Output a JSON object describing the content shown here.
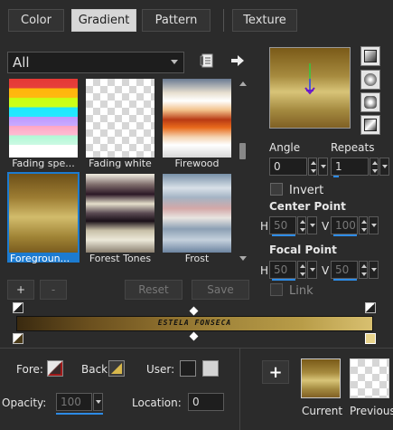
{
  "tabs": [
    {
      "label": "Color",
      "active": false
    },
    {
      "label": "Gradient",
      "active": true
    },
    {
      "label": "Pattern",
      "active": false
    },
    {
      "label": "Texture",
      "active": false
    }
  ],
  "category": {
    "selected": "All"
  },
  "gallery": {
    "items": [
      {
        "label": "Fading spe...",
        "selected": false
      },
      {
        "label": "Fading white",
        "selected": false
      },
      {
        "label": "Firewood",
        "selected": false
      },
      {
        "label": "Foregroun...",
        "selected": true
      },
      {
        "label": "Forest Tones",
        "selected": false
      },
      {
        "label": "Frost",
        "selected": false
      }
    ]
  },
  "angle": {
    "label": "Angle",
    "value": "0"
  },
  "repeats": {
    "label": "Repeats",
    "value": "1"
  },
  "invert": {
    "label": "Invert",
    "checked": false
  },
  "center_point": {
    "label": "Center Point",
    "h_label": "H",
    "h_value": "50",
    "v_label": "V",
    "v_value": "100"
  },
  "focal_point": {
    "label": "Focal Point",
    "h_label": "H",
    "h_value": "50",
    "v_label": "V",
    "v_value": "50"
  },
  "link": {
    "label": "Link",
    "checked": false
  },
  "buttons": {
    "add": "+",
    "remove": "-",
    "reset": "Reset",
    "save": "Save"
  },
  "gradient_bar": {
    "text": "ESTELA FONSECA"
  },
  "bottom": {
    "fore_label": "Fore:",
    "back_label": "Back:",
    "user_label": "User:",
    "opacity_label": "Opacity:",
    "opacity_value": "100",
    "location_label": "Location:",
    "location_value": "0"
  },
  "current": {
    "label": "Current",
    "add_button": "+"
  },
  "previous": {
    "label": "Previous"
  },
  "colors": {
    "accent": "#1c7bd0",
    "background": "#2b2b2b",
    "gold_dark": "#7a5a18",
    "gold_light": "#d8c478"
  }
}
